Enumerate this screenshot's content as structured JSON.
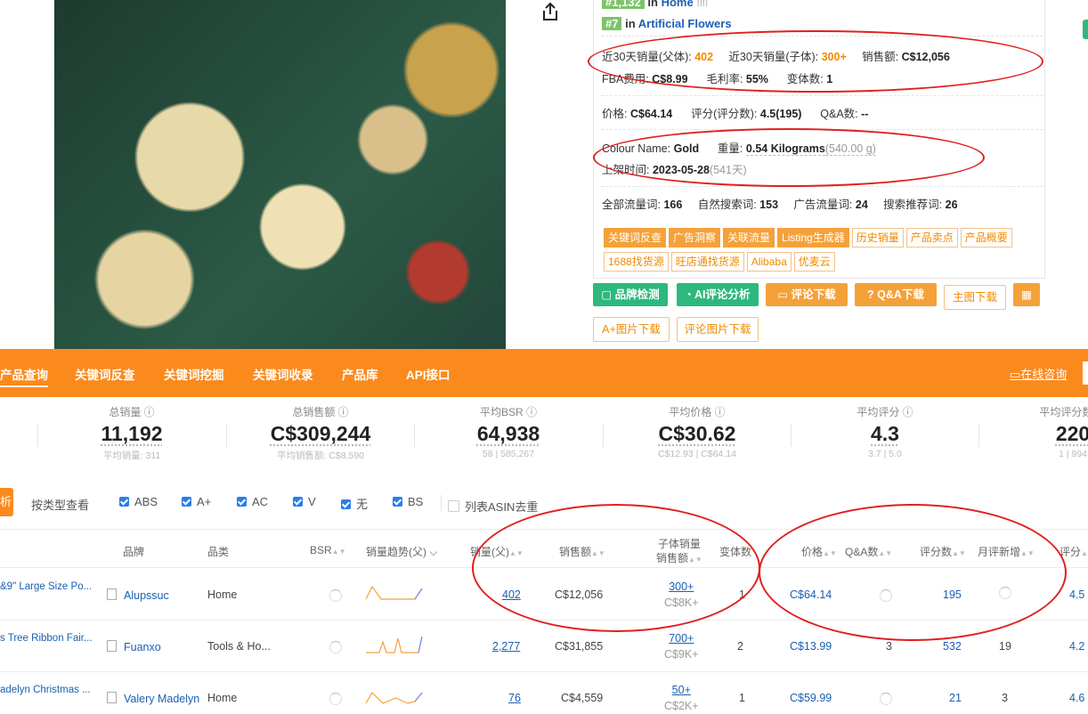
{
  "ranks": [
    {
      "badge": "#1,132",
      "prefix": "in",
      "category": "Home"
    },
    {
      "badge": "#7",
      "prefix": "in",
      "category": "Artificial Flowers"
    }
  ],
  "sales": {
    "parent_30d_label": "近30天销量(父体):",
    "parent_30d": "402",
    "child_30d_label": "近30天销量(子体):",
    "child_30d": "300+",
    "revenue_label": "销售额:",
    "revenue": "C$12,056",
    "fba_label": "FBA费用:",
    "fba": "C$8.99",
    "margin_label": "毛利率:",
    "margin": "55%",
    "variants_label": "变体数:",
    "variants": "1"
  },
  "price_row": {
    "price_label": "价格:",
    "price": "C$64.14",
    "rating_label": "评分(评分数):",
    "rating": "4.5(195)",
    "qa_label": "Q&A数:",
    "qa": "--"
  },
  "attr_row": {
    "colour_label": "Colour Name:",
    "colour": "Gold",
    "weight_label": "重量:",
    "weight": "0.54 Kilograms",
    "weight_g": "(540.00 g)",
    "date_label": "上架时间:",
    "date": "2023-05-28",
    "days": "(541天)"
  },
  "traffic_row": {
    "all_label": "全部流量词:",
    "all": "166",
    "organic_label": "自然搜索词:",
    "organic": "153",
    "ads_label": "广告流量词:",
    "ads": "24",
    "rec_label": "搜索推荐词:",
    "rec": "26"
  },
  "tags_solid": [
    "关键词反查",
    "广告洞察",
    "关联流量",
    "Listing生成器"
  ],
  "tags_outline_1": [
    "历史销量",
    "产品卖点",
    "产品概要"
  ],
  "tags_outline_2": [
    "1688找货源",
    "旺店通找货源",
    "Alibaba",
    "优麦云"
  ],
  "buttons": {
    "brand": "品牌检测",
    "ai": "AI评论分析",
    "reviews": "评论下载",
    "qa": "Q&A下载",
    "main_img": "主图下载",
    "aplus": "A+图片下载",
    "review_img": "评论图片下载"
  },
  "nav": {
    "items": [
      "产品查询",
      "关键词反查",
      "关键词挖掘",
      "关键词收录",
      "产品库",
      "API接口"
    ],
    "chat": "在线咨询"
  },
  "stats": [
    {
      "label": "总销量",
      "value": "11,192",
      "sub": "平均销量: 311"
    },
    {
      "label": "总销售额",
      "value": "C$309,244",
      "sub": "平均销售额: C$8,590"
    },
    {
      "label": "平均BSR",
      "value": "64,938",
      "sub": "58 | 585,267"
    },
    {
      "label": "平均价格",
      "value": "C$30.62",
      "sub": "C$12.93 | C$64.14"
    },
    {
      "label": "平均评分",
      "value": "4.3",
      "sub": "3.7 | 5.0"
    },
    {
      "label": "平均评分数",
      "value": "220",
      "sub": "1 | 994"
    }
  ],
  "filters": {
    "btn": "析",
    "view": "按类型查看",
    "checks": [
      "ABS",
      "A+",
      "AC",
      "V",
      "无",
      "BS"
    ],
    "dedupe": "列表ASIN去重"
  },
  "columns": {
    "brand": "品牌",
    "category": "品类",
    "bsr": "BSR",
    "trend": "销量趋势(父)",
    "sales": "销量(父)",
    "revenue": "销售额",
    "child_sales": "子体销量",
    "child_revenue": "销售额",
    "variants": "变体数",
    "price": "价格",
    "qa": "Q&A数",
    "reviews": "评分数",
    "monthly": "月评新增",
    "rating": "评分"
  },
  "rows": [
    {
      "title": "&9\" Large Size Po...",
      "brand": "Alupssuc",
      "category": "Home",
      "sales": "402",
      "revenue": "C$12,056",
      "child_sales": "300+",
      "child_revenue": "C$8K+",
      "variants": "1",
      "price": "C$64.14",
      "qa": "",
      "reviews": "195",
      "monthly": "",
      "rating": "4.5"
    },
    {
      "title": "s Tree Ribbon Fair...",
      "brand": "Fuanxo",
      "category": "Tools & Ho...",
      "sales": "2,277",
      "revenue": "C$31,855",
      "child_sales": "700+",
      "child_revenue": "C$9K+",
      "variants": "2",
      "price": "C$13.99",
      "qa": "3",
      "reviews": "532",
      "monthly": "19",
      "rating": "4.2"
    },
    {
      "title": "adelyn Christmas ...",
      "brand": "Valery Madelyn",
      "category": "Home",
      "sales": "76",
      "revenue": "C$4,559",
      "child_sales": "50+",
      "child_revenue": "C$2K+",
      "variants": "1",
      "price": "C$59.99",
      "qa": "",
      "reviews": "21",
      "monthly": "3",
      "rating": "4.6"
    }
  ],
  "colors": {
    "accent": "#fb8a1d",
    "green": "#2db87d",
    "link": "#1a5fb4",
    "annotation": "#e02020"
  }
}
